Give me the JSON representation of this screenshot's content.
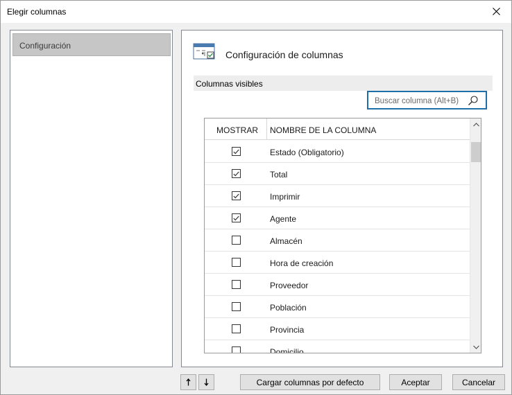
{
  "window": {
    "title": "Elegir columnas"
  },
  "sidebar": {
    "items": [
      {
        "label": "Configuración",
        "selected": true
      }
    ]
  },
  "panel": {
    "title": "Configuración de columnas",
    "icon": "columns-config-icon",
    "section_label": "Columnas visibles",
    "search": {
      "placeholder": "Buscar columna (Alt+B)",
      "value": ""
    }
  },
  "grid": {
    "columns": [
      "MOSTRAR",
      "NOMBRE DE LA COLUMNA"
    ],
    "rows": [
      {
        "show": true,
        "name": "Estado (Obligatorio)"
      },
      {
        "show": true,
        "name": "Total"
      },
      {
        "show": true,
        "name": "Imprimir"
      },
      {
        "show": true,
        "name": "Agente"
      },
      {
        "show": false,
        "name": "Almacén"
      },
      {
        "show": false,
        "name": "Hora de creación"
      },
      {
        "show": false,
        "name": "Proveedor"
      },
      {
        "show": false,
        "name": "Población"
      },
      {
        "show": false,
        "name": "Provincia"
      },
      {
        "show": false,
        "name": "Domicilio"
      }
    ]
  },
  "footer": {
    "move_up_icon": "arrow-up-icon",
    "move_down_icon": "arrow-down-icon",
    "load_defaults_label": "Cargar columnas por defecto",
    "accept_label": "Aceptar",
    "cancel_label": "Cancelar"
  },
  "colors": {
    "accent": "#1e6fa8",
    "selection": "#c6c6c6",
    "check": "#333333"
  }
}
